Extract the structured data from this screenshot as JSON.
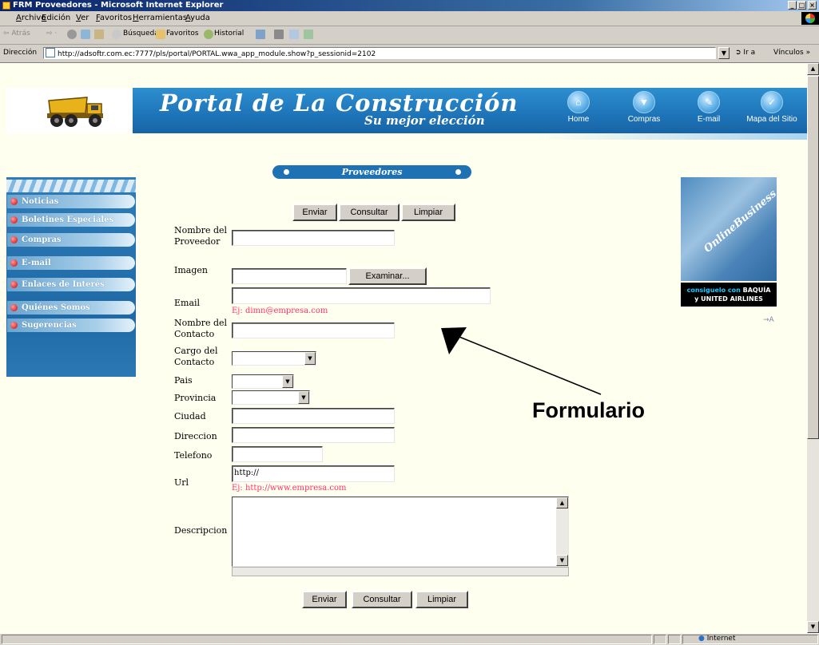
{
  "window": {
    "title": "FRM Proveedores - Microsoft Internet Explorer",
    "controls": [
      "_",
      "□",
      "×"
    ]
  },
  "menu": [
    "Archivo",
    "Edición",
    "Ver",
    "Favoritos",
    "Herramientas",
    "Ayuda"
  ],
  "toolbar": {
    "back": "⇦ Atrás",
    "search": "Búsqueda",
    "favorites": "Favoritos",
    "history": "Historial"
  },
  "address": {
    "label": "Dirección",
    "url": "http://adsoftr.com.ec:7777/pls/portal/PORTAL.wwa_app_module.show?p_sessionid=2102",
    "go": "Ir a",
    "links": "Vínculos »"
  },
  "header": {
    "title": "Portal de La Construcción",
    "subtitle": "Su mejor elección",
    "nav": [
      {
        "label": "Home",
        "icon": "house-icon",
        "glyph": "⌂"
      },
      {
        "label": "Compras",
        "icon": "basket-icon",
        "glyph": "▼"
      },
      {
        "label": "E-mail",
        "icon": "pencil-icon",
        "glyph": "✎"
      },
      {
        "label": "Mapa del Sitio",
        "icon": "check-icon",
        "glyph": "✓"
      }
    ]
  },
  "section_title": "Proveedores",
  "left_menu": [
    "Noticias",
    "Boletines Especiales",
    "Compras",
    "E-mail",
    "Enlaces de Interés",
    "Quiénes Somos",
    "Sugerencias"
  ],
  "ad": {
    "brand": "OnlineBusiness",
    "line1_cyan": "consiguelo con",
    "line1_white": "BAQUÍA",
    "line2": "y UNITED AIRLINES",
    "arrow": "→A"
  },
  "form": {
    "buttons": {
      "send": "Enviar",
      "query": "Consultar",
      "clear": "Limpiar",
      "browse": "Examinar..."
    },
    "labels": {
      "nombre_proveedor": "Nombre del Proveedor",
      "imagen": "Imagen",
      "email": "Email",
      "nombre_contacto": "Nombre del Contacto",
      "cargo_contacto": "Cargo del Contacto",
      "pais": "Pais",
      "provincia": "Provincia",
      "ciudad": "Ciudad",
      "direccion": "Direccion",
      "telefono": "Telefono",
      "url": "Url",
      "descripcion": "Descripcion"
    },
    "values": {
      "url": "http://"
    },
    "hints": {
      "email": "Ej: dimn@empresa.com",
      "url": "Ej: http://www.empresa.com"
    }
  },
  "annotation": "Formulario",
  "status": {
    "zone": "Internet"
  }
}
